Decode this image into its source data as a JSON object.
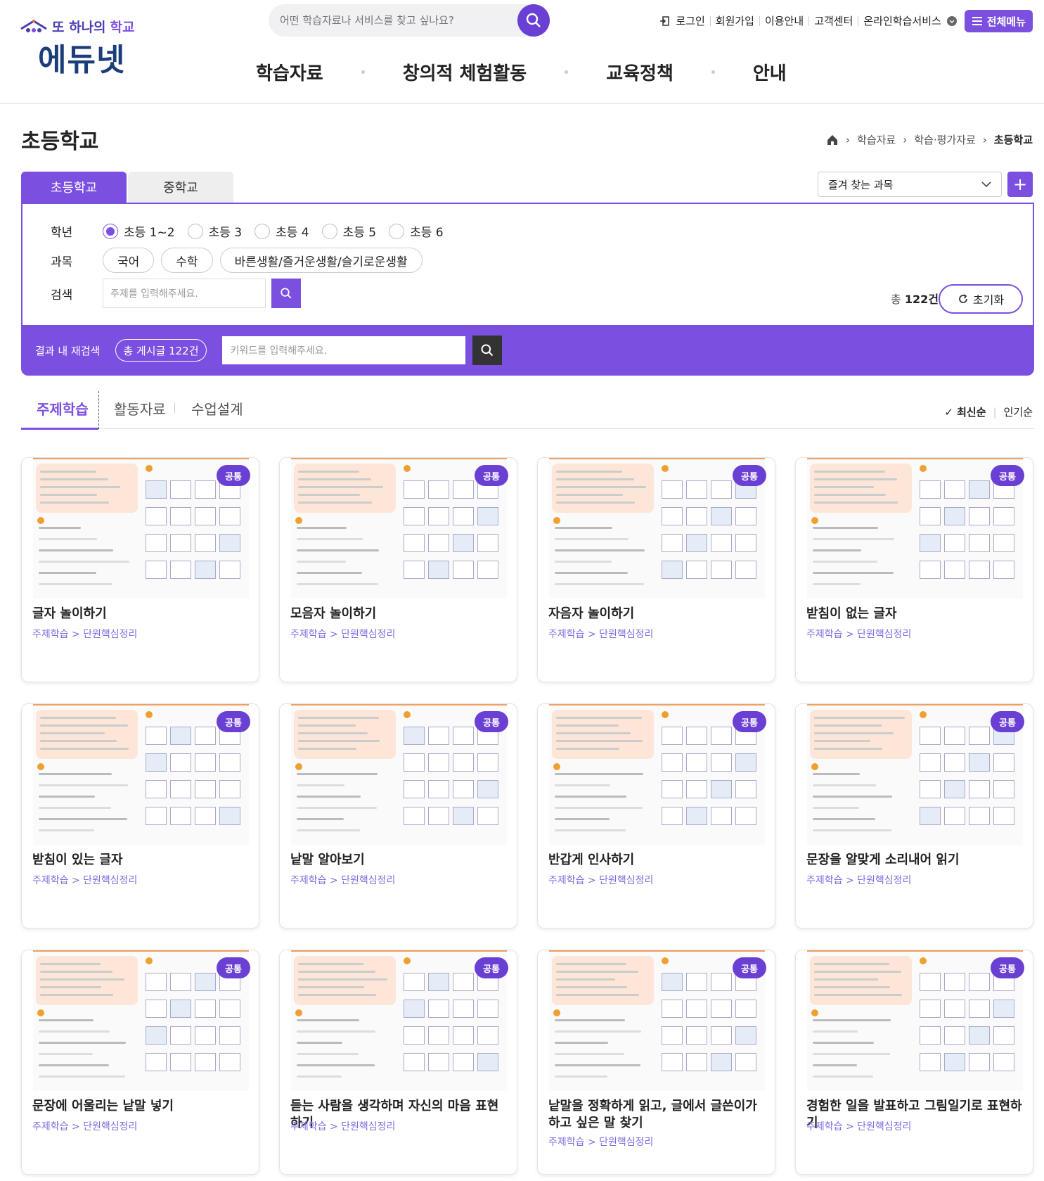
{
  "header": {
    "logo_sub_a": "또 하나의",
    "logo_sub_b": "학교",
    "logo_main": "에듀넷",
    "search_placeholder": "어떤 학습자료나 서비스를 찾고 싶나요?",
    "util": [
      "로그인",
      "회원가입",
      "이용안내",
      "고객센터",
      "온라인학습서비스"
    ],
    "all_menu": "전체메뉴",
    "gnb": [
      "학습자료",
      "창의적 체험활동",
      "교육정책",
      "안내"
    ]
  },
  "page": {
    "title": "초등학교",
    "breadcrumb": [
      "학습자료",
      "학습·평가자료",
      "초등학교"
    ]
  },
  "school_tabs": [
    "초등학교",
    "중학교"
  ],
  "favorites": {
    "label": "즐겨 찾는 과목",
    "add": "+"
  },
  "filter": {
    "grade_label": "학년",
    "grades": [
      "초등 1~2",
      "초등 3",
      "초등 4",
      "초등 5",
      "초등 6"
    ],
    "selected_grade": 0,
    "subject_label": "과목",
    "subjects": [
      "국어",
      "수학",
      "바른생활/즐거운생활/슬기로운생활"
    ],
    "search_label": "검색",
    "search_placeholder": "주제를 입력해주세요.",
    "total_prefix": "총",
    "total_count": "122건",
    "reset": "초기화"
  },
  "result_bar": {
    "label": "결과 내 재검색",
    "count": "총 게시글 122건",
    "placeholder": "키워드를 입력해주세요."
  },
  "content_tabs": [
    "주제학습",
    "활동자료",
    "수업설계"
  ],
  "sort": [
    "최신순",
    "인기순"
  ],
  "cards": [
    {
      "title": "글자 놀이하기",
      "category": "주제학습 > 단원핵심정리",
      "badge": "공통"
    },
    {
      "title": "모음자 놀이하기",
      "category": "주제학습 > 단원핵심정리",
      "badge": "공통"
    },
    {
      "title": "자음자 놀이하기",
      "category": "주제학습 > 단원핵심정리",
      "badge": "공통"
    },
    {
      "title": "받침이 없는 글자",
      "category": "주제학습 > 단원핵심정리",
      "badge": "공통"
    },
    {
      "title": "받침이 있는 글자",
      "category": "주제학습 > 단원핵심정리",
      "badge": "공통"
    },
    {
      "title": "낱말 알아보기",
      "category": "주제학습 > 단원핵심정리",
      "badge": "공통"
    },
    {
      "title": "반갑게 인사하기",
      "category": "주제학습 > 단원핵심정리",
      "badge": "공통"
    },
    {
      "title": "문장을 알맞게 소리내어 읽기",
      "category": "주제학습 > 단원핵심정리",
      "badge": "공통"
    },
    {
      "title": "문장에 어울리는 낱말 넣기",
      "category": "주제학습 > 단원핵심정리",
      "badge": "공통"
    },
    {
      "title": "듣는 사람을 생각하며 자신의 마음 표현하기",
      "category": "주제학습 > 단원핵심정리",
      "badge": "공통"
    },
    {
      "title": "낱말을 정확하게 읽고, 글에서 글쓴이가 하고 싶은 말 찾기",
      "category": "주제학습 > 단원핵심정리",
      "badge": "공통"
    },
    {
      "title": "경험한 일을 발표하고 그림일기로 표현하기",
      "category": "주제학습 > 단원핵심정리",
      "badge": "공통"
    }
  ],
  "colors": {
    "accent": "#7b4fe0",
    "badge": "#6a3fd4",
    "category": "#7b6fe0"
  }
}
